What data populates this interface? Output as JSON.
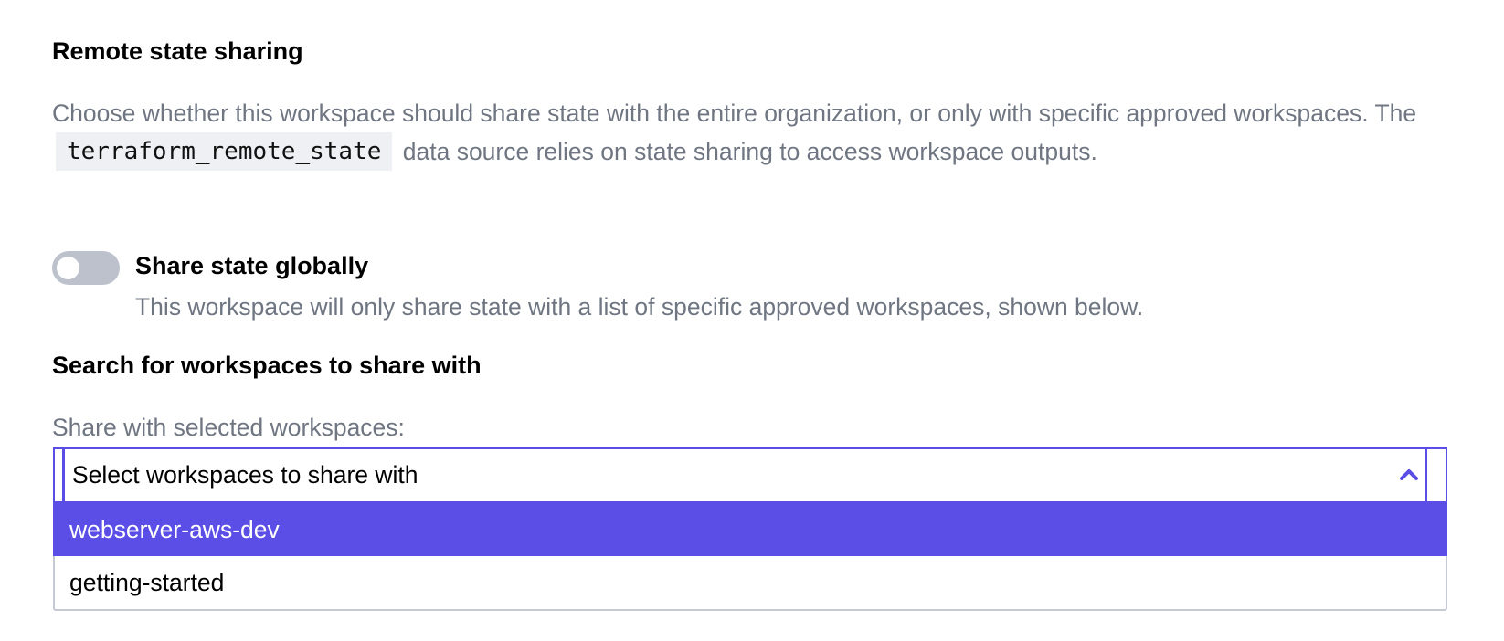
{
  "remote_state": {
    "title": "Remote state sharing",
    "description_before": "Choose whether this workspace should share state with the entire organization, or only with specific approved workspaces. The",
    "code": "terraform_remote_state",
    "description_after": "data source relies on state sharing to access workspace outputs."
  },
  "share_globally": {
    "label": "Share state globally",
    "enabled": false,
    "help": "This workspace will only share state with a list of specific approved workspaces, shown below."
  },
  "search": {
    "title": "Search for workspaces to share with",
    "field_label": "Share with selected workspaces:",
    "placeholder": "Select workspaces to share with",
    "options": [
      {
        "label": "webserver-aws-dev",
        "highlighted": true
      },
      {
        "label": "getting-started",
        "highlighted": false
      }
    ]
  },
  "colors": {
    "accent": "#5b4ee6",
    "muted_text": "#6f7682",
    "toggle_off": "#bcc1cc"
  },
  "icons": {
    "dropdown_toggle": "chevron-up-icon"
  }
}
